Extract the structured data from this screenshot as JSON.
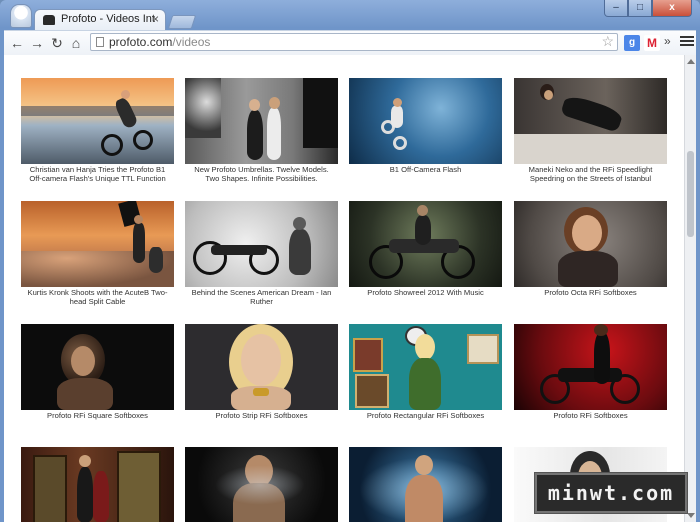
{
  "browser": {
    "tab_title": "Profoto - Videos Int",
    "tab_close": "×",
    "url_domain": "profoto.com",
    "url_path": "/videos",
    "window_buttons": {
      "minimize": "–",
      "maximize": "□",
      "close": "x"
    },
    "extensions": {
      "google": "g",
      "gmail": "M",
      "more": "»"
    }
  },
  "videos": [
    {
      "caption": "Christian van Hanja Tries the Profoto B1 Off-camera Flash's Unique TTL Function"
    },
    {
      "caption": "New Profoto Umbrellas. Twelve Models. Two Shapes. Infinite Possibilities."
    },
    {
      "caption": "B1 Off-Camera Flash"
    },
    {
      "caption": "Maneki Neko and the RFi Speedlight Speedring on the Streets of Istanbul"
    },
    {
      "caption": "Kurtis Kronk Shoots with the AcuteB Two-head Split Cable"
    },
    {
      "caption": "Behind the Scenes American Dream - Ian Ruther"
    },
    {
      "caption": "Profoto Showreel 2012 With Music"
    },
    {
      "caption": "Profoto Octa RFi Softboxes"
    },
    {
      "caption": "Profoto RFi Square Softboxes"
    },
    {
      "caption": "Profoto Strip RFi Softboxes"
    },
    {
      "caption": "Profoto Rectangular RFi Softboxes"
    },
    {
      "caption": "Profoto RFi Softboxes"
    },
    {
      "caption": ""
    },
    {
      "caption": ""
    },
    {
      "caption": ""
    },
    {
      "caption": ""
    }
  ],
  "watermark": {
    "text": "minwt.com"
  }
}
